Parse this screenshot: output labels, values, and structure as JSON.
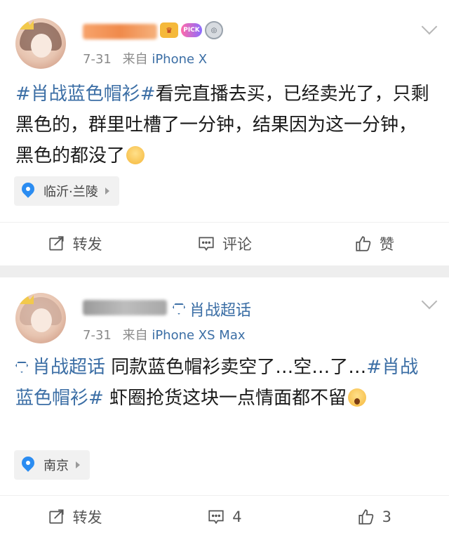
{
  "post1": {
    "meta": {
      "date": "7-31",
      "from_label": "来自",
      "source": "iPhone X"
    },
    "content": {
      "topic": "#肖战蓝色帽衫#",
      "text": "看完直播去买，已经卖光了，只剩黑色的，群里吐槽了一分钟，结果因为这一分钟，黑色的都没了"
    },
    "location": "临沂·兰陵",
    "actions": {
      "repost": "转发",
      "comment": "评论",
      "like": "赞"
    }
  },
  "post2": {
    "huati_label": "肖战超话",
    "meta": {
      "date": "7-31",
      "from_label": "来自",
      "source": "iPhone XS Max"
    },
    "content": {
      "topic1": "肖战超话",
      "text1": " 同款蓝色帽衫卖空了…空…了…",
      "topic2": "#肖战蓝色帽衫#",
      "text2": " 虾圈抢货这块一点情面都不留"
    },
    "location": "南京",
    "actions": {
      "repost": "转发",
      "comment": "4",
      "like": "3"
    }
  },
  "colors": {
    "accent": "#3b6ea5",
    "divider": "#eeeeee",
    "location_bg": "#f1f1f1"
  },
  "icons": {
    "repost": "repost-icon",
    "comment": "comment-icon",
    "like": "thumbs-up-icon",
    "location": "location-pin-icon",
    "chevron": "chevron-down-icon"
  }
}
